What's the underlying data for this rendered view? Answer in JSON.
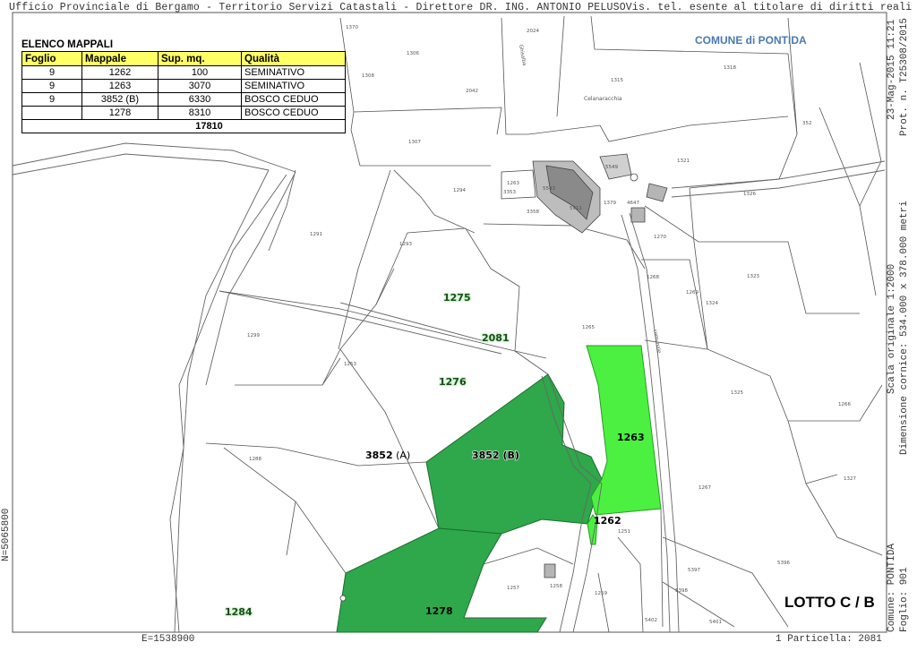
{
  "header": {
    "text": "Ufficio Provinciale di Bergamo - Territorio Servizi Catastali - Direttore DR. ING. ANTONIO PELUSOVis. tel. esente al titolare di diritti reali"
  },
  "legend": {
    "title": "ELENCO MAPPALI",
    "columns": [
      "Foglio",
      "Mappale",
      "Sup. mq.",
      "Qualità"
    ],
    "rows": [
      {
        "foglio": "9",
        "mappale": "1262",
        "sup": "100",
        "qualita": "SEMINATIVO"
      },
      {
        "foglio": "9",
        "mappale": "1263",
        "sup": "3070",
        "qualita": "SEMINATIVO"
      },
      {
        "foglio": "9",
        "mappale": "3852 (B)",
        "sup": "6330",
        "qualita": "BOSCO CEDUO"
      },
      {
        "foglio": "",
        "mappale": "1278",
        "sup": "8310",
        "qualita": "BOSCO CEDUO"
      }
    ],
    "total": "17810"
  },
  "comune_label": "COMUNE di PONTIDA",
  "lotto": "LOTTO C / B",
  "right_side": {
    "date": "23-Mag-2015 11:21",
    "prot": "Prot. n. T25308/2015",
    "scala": "Scala originale 1:2000",
    "dimensione": "Dimensione cornice: 534.000 x 378.000 metri",
    "comune": "Comune: PONTIDA",
    "foglio": "Foglio: 901"
  },
  "left_side": {
    "north_coord": "N=5065800"
  },
  "bottom": {
    "east_coord": "E=1538900",
    "particella": "1 Particella: 2081"
  },
  "colors": {
    "dark_green": "#2ea84a",
    "light_green": "#4cf040",
    "legend_header": "#ffff66",
    "comune_blue": "#4a7ab0"
  },
  "highlight_labels": [
    {
      "id": "p1275",
      "text": "1275"
    },
    {
      "id": "p2081",
      "text": "2081"
    },
    {
      "id": "p1276",
      "text": "1276"
    },
    {
      "id": "p1263",
      "text": "1263"
    },
    {
      "id": "p3852a",
      "text": "3852",
      "suffix": " (A)"
    },
    {
      "id": "p3852b",
      "text": "3852 (B)"
    },
    {
      "id": "p1262",
      "text": "1262"
    },
    {
      "id": "p1278",
      "text": "1278"
    },
    {
      "id": "p1284",
      "text": "1284"
    }
  ],
  "parcel_numbers": [
    "1370",
    "2024",
    "1306",
    "1308",
    "2042",
    "1315",
    "1318",
    "1307",
    "1321",
    "1326",
    "1291",
    "1293",
    "1294",
    "1299",
    "1323",
    "1324",
    "1268",
    "1269",
    "1265",
    "1253",
    "1325",
    "1266",
    "1267",
    "1327",
    "1288",
    "1251",
    "5397",
    "5396",
    "5398",
    "5402",
    "5401",
    "1257",
    "1259",
    "1258",
    "4647",
    "1270",
    "352",
    "3353",
    "3358",
    "5911",
    "1379",
    "5549",
    "5543",
    "1263"
  ],
  "place_names": {
    "cascina": "Celanaracchia",
    "road": "comunale",
    "road2": "Ghisalba"
  }
}
